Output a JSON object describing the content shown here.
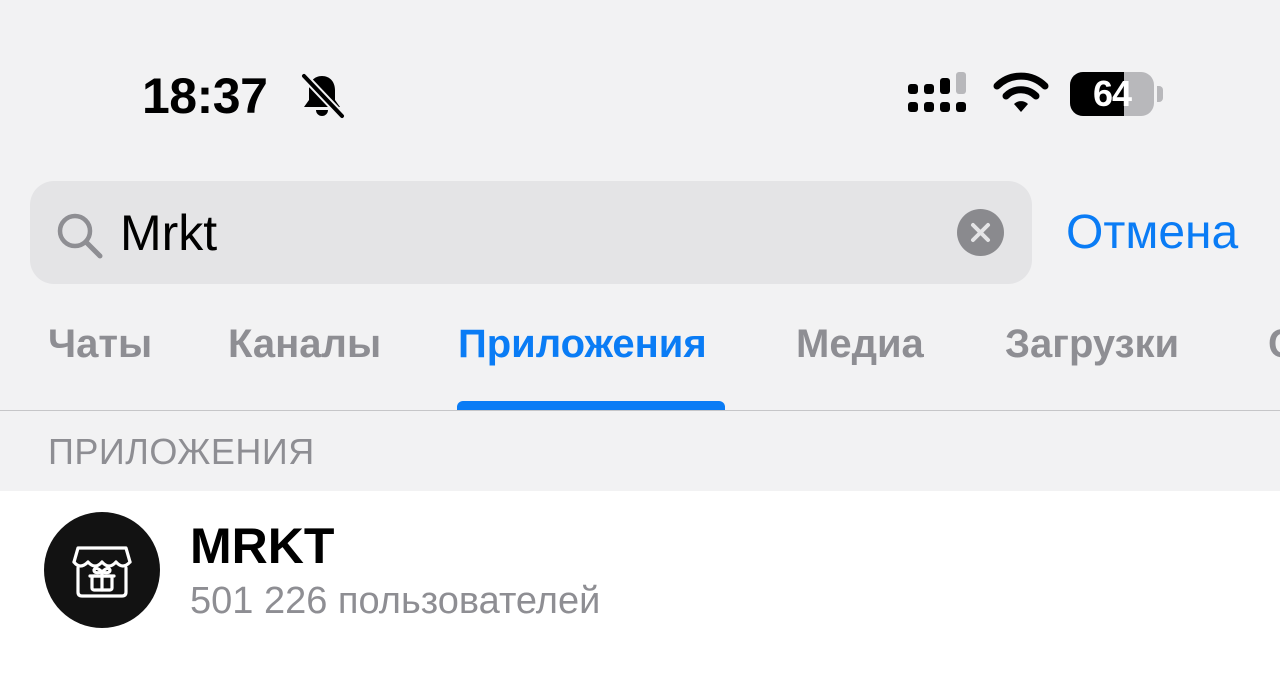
{
  "status_bar": {
    "time": "18:37",
    "mute_icon": "bell-slash-icon",
    "signal_icon": "cellular-signal-icon",
    "wifi_icon": "wifi-icon",
    "battery_level": 64,
    "battery_label": "64"
  },
  "search": {
    "query": "Mrkt",
    "search_icon": "magnifying-glass-icon",
    "clear_icon": "close-icon",
    "cancel_label": "Отмена"
  },
  "tabs": [
    {
      "label": "Чаты",
      "active": false
    },
    {
      "label": "Каналы",
      "active": false
    },
    {
      "label": "Приложения",
      "active": true
    },
    {
      "label": "Медиа",
      "active": false
    },
    {
      "label": "Загрузки",
      "active": false
    },
    {
      "label": "С",
      "active": false
    }
  ],
  "section": {
    "title": "ПРИЛОЖЕНИЯ"
  },
  "results": [
    {
      "title": "MRKT",
      "subtitle": "501 226 пользователей",
      "avatar_icon": "storefront-gift-icon"
    }
  ],
  "colors": {
    "accent": "#0a7cf5",
    "background": "#f2f2f3",
    "search_field": "#e4e4e6",
    "secondary_text": "#8e8e93",
    "avatar_bg": "#121212"
  }
}
